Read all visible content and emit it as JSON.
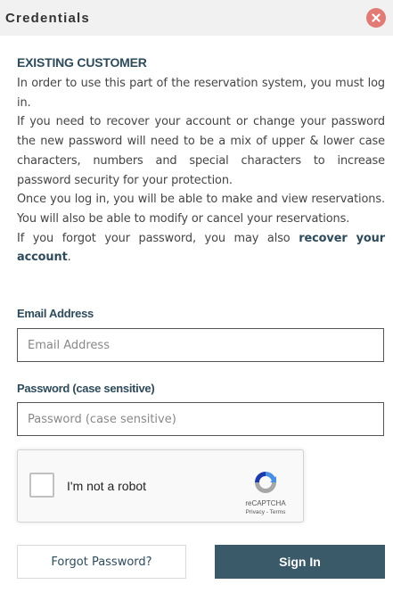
{
  "header": {
    "title": "Credentials",
    "close_icon": "close-icon",
    "close_color": "#e27b76"
  },
  "intro": {
    "heading": "EXISTING CUSTOMER",
    "p1": "In order to use this part of the reservation system, you must log in.",
    "p2": "If you need to recover your account or change your password the new password will need to be a mix of upper & lower case characters, numbers and special characters to increase password security for your protection.",
    "p3": "Once you log in, you will be able to make and view reservations. You will also be able to modify or cancel your reservations.",
    "p4_prefix": "If you forgot your password, you may also ",
    "p4_link": "recover your account",
    "p4_suffix": "."
  },
  "email": {
    "label": "Email Address",
    "placeholder": "Email Address",
    "value": ""
  },
  "password": {
    "label": "Password (case sensitive)",
    "placeholder": "Password (case sensitive)",
    "value": ""
  },
  "recaptcha": {
    "label": "I'm not a robot",
    "brand": "reCAPTCHA",
    "links": "Privacy - Terms",
    "checked": false,
    "logo_icon": "recaptcha-logo-icon"
  },
  "buttons": {
    "forgot": "Forgot Password?",
    "signin": "Sign In"
  },
  "colors": {
    "accent": "#2e4b5b",
    "primary_button": "#3a5a6a",
    "header_bg": "#f1f1f1"
  }
}
